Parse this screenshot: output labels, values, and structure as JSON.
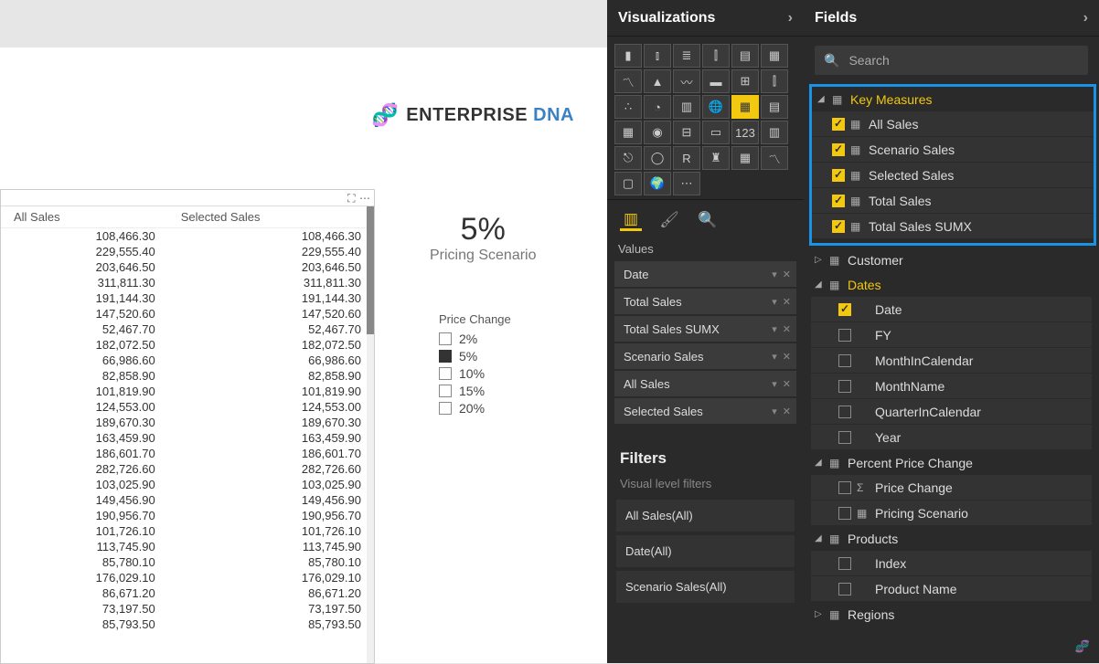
{
  "panels": {
    "visualizations_title": "Visualizations",
    "fields_title": "Fields",
    "values_label": "Values",
    "filters_label": "Filters",
    "visual_filters_label": "Visual level filters"
  },
  "search": {
    "placeholder": "Search"
  },
  "logo": {
    "text1": "ENTERPRISE",
    "text2": "DNA"
  },
  "kpi": {
    "value": "5%",
    "label": "Pricing Scenario"
  },
  "slicer": {
    "title": "Price Change",
    "items": [
      {
        "label": "2%",
        "checked": false
      },
      {
        "label": "5%",
        "checked": true
      },
      {
        "label": "10%",
        "checked": false
      },
      {
        "label": "15%",
        "checked": false
      },
      {
        "label": "20%",
        "checked": false
      }
    ]
  },
  "table": {
    "headers": [
      "All Sales",
      "Selected Sales"
    ],
    "rows": [
      [
        "108,466.30",
        "108,466.30"
      ],
      [
        "229,555.40",
        "229,555.40"
      ],
      [
        "203,646.50",
        "203,646.50"
      ],
      [
        "311,811.30",
        "311,811.30"
      ],
      [
        "191,144.30",
        "191,144.30"
      ],
      [
        "147,520.60",
        "147,520.60"
      ],
      [
        "52,467.70",
        "52,467.70"
      ],
      [
        "182,072.50",
        "182,072.50"
      ],
      [
        "66,986.60",
        "66,986.60"
      ],
      [
        "82,858.90",
        "82,858.90"
      ],
      [
        "101,819.90",
        "101,819.90"
      ],
      [
        "124,553.00",
        "124,553.00"
      ],
      [
        "189,670.30",
        "189,670.30"
      ],
      [
        "163,459.90",
        "163,459.90"
      ],
      [
        "186,601.70",
        "186,601.70"
      ],
      [
        "282,726.60",
        "282,726.60"
      ],
      [
        "103,025.90",
        "103,025.90"
      ],
      [
        "149,456.90",
        "149,456.90"
      ],
      [
        "190,956.70",
        "190,956.70"
      ],
      [
        "101,726.10",
        "101,726.10"
      ],
      [
        "113,745.90",
        "113,745.90"
      ],
      [
        "85,780.10",
        "85,780.10"
      ],
      [
        "176,029.10",
        "176,029.10"
      ],
      [
        "86,671.20",
        "86,671.20"
      ],
      [
        "73,197.50",
        "73,197.50"
      ],
      [
        "85,793.50",
        "85,793.50"
      ]
    ]
  },
  "wells": [
    "Date",
    "Total Sales",
    "Total Sales SUMX",
    "Scenario Sales",
    "All Sales",
    "Selected Sales"
  ],
  "filters": [
    "All Sales(All)",
    "Date(All)",
    "Scenario Sales(All)"
  ],
  "fields": {
    "key_measures": {
      "label": "Key Measures",
      "items": [
        "All Sales",
        "Scenario Sales",
        "Selected Sales",
        "Total Sales",
        "Total Sales SUMX"
      ]
    },
    "customer": "Customer",
    "dates": {
      "label": "Dates",
      "items": [
        {
          "name": "Date",
          "checked": true
        },
        {
          "name": "FY",
          "checked": false
        },
        {
          "name": "MonthInCalendar",
          "checked": false
        },
        {
          "name": "MonthName",
          "checked": false
        },
        {
          "name": "QuarterInCalendar",
          "checked": false
        },
        {
          "name": "Year",
          "checked": false
        }
      ]
    },
    "percent_price_change": {
      "label": "Percent Price Change",
      "items": [
        {
          "name": "Price Change",
          "icon": "Σ"
        },
        {
          "name": "Pricing Scenario",
          "icon": "▦"
        }
      ]
    },
    "products": {
      "label": "Products",
      "items": [
        "Index",
        "Product Name"
      ]
    },
    "regions": "Regions"
  }
}
